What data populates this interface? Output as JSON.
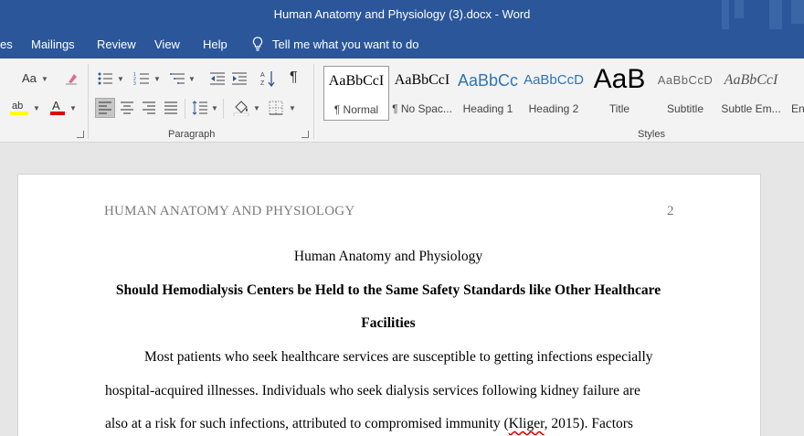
{
  "window": {
    "title": "Human Anatomy and Physiology (3).docx  -  Word"
  },
  "tabs": [
    "es",
    "Mailings",
    "Review",
    "View",
    "Help"
  ],
  "tell_me": "Tell me what you want to do",
  "ribbon": {
    "font_group": {
      "font_size_btn": "Aa"
    },
    "paragraph_label": "Paragraph",
    "styles_label": "Styles",
    "styles": [
      {
        "preview": "AaBbCcI",
        "label": "¶ Normal"
      },
      {
        "preview": "AaBbCcI",
        "label": "¶ No Spac..."
      },
      {
        "preview": "AaBbCc",
        "label": "Heading 1"
      },
      {
        "preview": "AaBbCcD",
        "label": "Heading 2"
      },
      {
        "preview": "AaB",
        "label": "Title"
      },
      {
        "preview": "AaBbCcD",
        "label": "Subtitle"
      },
      {
        "preview": "AaBbCcI",
        "label": "Subtle Em..."
      },
      {
        "preview": "",
        "label": "En"
      }
    ]
  },
  "document": {
    "running_head": "HUMAN ANATOMY AND PHYSIOLOGY",
    "page_number": "2",
    "title": "Human Anatomy and Physiology",
    "heading_line1": "Should Hemodialysis Centers be Held to the Same Safety Standards like Other Healthcare",
    "heading_line2": "Facilities",
    "body_line1": "Most patients who seek healthcare services are susceptible to getting infections especially",
    "body_line2": "hospital-acquired illnesses. Individuals who seek dialysis services following kidney failure are",
    "body_line3_a": "also at a risk for such infections, attributed to compromised immunity (",
    "body_line3_cite": "Kliger",
    "body_line3_b": ", 2015). Factors"
  },
  "colors": {
    "brand": "#2b579a",
    "ribbon": "#f3f3f3",
    "canvas": "#e6e6e6"
  }
}
